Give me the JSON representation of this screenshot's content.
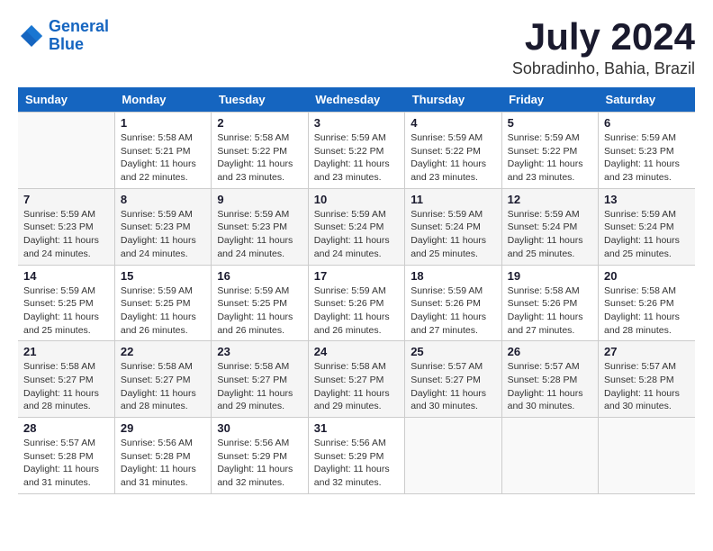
{
  "logo": {
    "line1": "General",
    "line2": "Blue"
  },
  "title": "July 2024",
  "subtitle": "Sobradinho, Bahia, Brazil",
  "headers": [
    "Sunday",
    "Monday",
    "Tuesday",
    "Wednesday",
    "Thursday",
    "Friday",
    "Saturday"
  ],
  "weeks": [
    [
      {
        "day": "",
        "info": ""
      },
      {
        "day": "1",
        "info": "Sunrise: 5:58 AM\nSunset: 5:21 PM\nDaylight: 11 hours\nand 22 minutes."
      },
      {
        "day": "2",
        "info": "Sunrise: 5:58 AM\nSunset: 5:22 PM\nDaylight: 11 hours\nand 23 minutes."
      },
      {
        "day": "3",
        "info": "Sunrise: 5:59 AM\nSunset: 5:22 PM\nDaylight: 11 hours\nand 23 minutes."
      },
      {
        "day": "4",
        "info": "Sunrise: 5:59 AM\nSunset: 5:22 PM\nDaylight: 11 hours\nand 23 minutes."
      },
      {
        "day": "5",
        "info": "Sunrise: 5:59 AM\nSunset: 5:22 PM\nDaylight: 11 hours\nand 23 minutes."
      },
      {
        "day": "6",
        "info": "Sunrise: 5:59 AM\nSunset: 5:23 PM\nDaylight: 11 hours\nand 23 minutes."
      }
    ],
    [
      {
        "day": "7",
        "info": "Sunrise: 5:59 AM\nSunset: 5:23 PM\nDaylight: 11 hours\nand 24 minutes."
      },
      {
        "day": "8",
        "info": "Sunrise: 5:59 AM\nSunset: 5:23 PM\nDaylight: 11 hours\nand 24 minutes."
      },
      {
        "day": "9",
        "info": "Sunrise: 5:59 AM\nSunset: 5:23 PM\nDaylight: 11 hours\nand 24 minutes."
      },
      {
        "day": "10",
        "info": "Sunrise: 5:59 AM\nSunset: 5:24 PM\nDaylight: 11 hours\nand 24 minutes."
      },
      {
        "day": "11",
        "info": "Sunrise: 5:59 AM\nSunset: 5:24 PM\nDaylight: 11 hours\nand 25 minutes."
      },
      {
        "day": "12",
        "info": "Sunrise: 5:59 AM\nSunset: 5:24 PM\nDaylight: 11 hours\nand 25 minutes."
      },
      {
        "day": "13",
        "info": "Sunrise: 5:59 AM\nSunset: 5:24 PM\nDaylight: 11 hours\nand 25 minutes."
      }
    ],
    [
      {
        "day": "14",
        "info": "Sunrise: 5:59 AM\nSunset: 5:25 PM\nDaylight: 11 hours\nand 25 minutes."
      },
      {
        "day": "15",
        "info": "Sunrise: 5:59 AM\nSunset: 5:25 PM\nDaylight: 11 hours\nand 26 minutes."
      },
      {
        "day": "16",
        "info": "Sunrise: 5:59 AM\nSunset: 5:25 PM\nDaylight: 11 hours\nand 26 minutes."
      },
      {
        "day": "17",
        "info": "Sunrise: 5:59 AM\nSunset: 5:26 PM\nDaylight: 11 hours\nand 26 minutes."
      },
      {
        "day": "18",
        "info": "Sunrise: 5:59 AM\nSunset: 5:26 PM\nDaylight: 11 hours\nand 27 minutes."
      },
      {
        "day": "19",
        "info": "Sunrise: 5:58 AM\nSunset: 5:26 PM\nDaylight: 11 hours\nand 27 minutes."
      },
      {
        "day": "20",
        "info": "Sunrise: 5:58 AM\nSunset: 5:26 PM\nDaylight: 11 hours\nand 28 minutes."
      }
    ],
    [
      {
        "day": "21",
        "info": "Sunrise: 5:58 AM\nSunset: 5:27 PM\nDaylight: 11 hours\nand 28 minutes."
      },
      {
        "day": "22",
        "info": "Sunrise: 5:58 AM\nSunset: 5:27 PM\nDaylight: 11 hours\nand 28 minutes."
      },
      {
        "day": "23",
        "info": "Sunrise: 5:58 AM\nSunset: 5:27 PM\nDaylight: 11 hours\nand 29 minutes."
      },
      {
        "day": "24",
        "info": "Sunrise: 5:58 AM\nSunset: 5:27 PM\nDaylight: 11 hours\nand 29 minutes."
      },
      {
        "day": "25",
        "info": "Sunrise: 5:57 AM\nSunset: 5:27 PM\nDaylight: 11 hours\nand 30 minutes."
      },
      {
        "day": "26",
        "info": "Sunrise: 5:57 AM\nSunset: 5:28 PM\nDaylight: 11 hours\nand 30 minutes."
      },
      {
        "day": "27",
        "info": "Sunrise: 5:57 AM\nSunset: 5:28 PM\nDaylight: 11 hours\nand 30 minutes."
      }
    ],
    [
      {
        "day": "28",
        "info": "Sunrise: 5:57 AM\nSunset: 5:28 PM\nDaylight: 11 hours\nand 31 minutes."
      },
      {
        "day": "29",
        "info": "Sunrise: 5:56 AM\nSunset: 5:28 PM\nDaylight: 11 hours\nand 31 minutes."
      },
      {
        "day": "30",
        "info": "Sunrise: 5:56 AM\nSunset: 5:29 PM\nDaylight: 11 hours\nand 32 minutes."
      },
      {
        "day": "31",
        "info": "Sunrise: 5:56 AM\nSunset: 5:29 PM\nDaylight: 11 hours\nand 32 minutes."
      },
      {
        "day": "",
        "info": ""
      },
      {
        "day": "",
        "info": ""
      },
      {
        "day": "",
        "info": ""
      }
    ]
  ]
}
